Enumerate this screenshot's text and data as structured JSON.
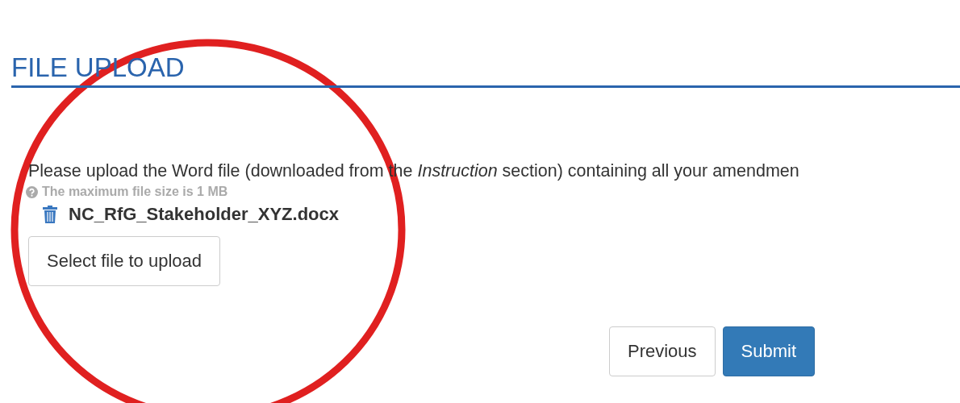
{
  "heading": "FILE UPLOAD",
  "instruction": "Please upload the Word file (downloaded from the *Instruction* section) containing all your amendmen",
  "help_text": "The maximum file size is 1 MB",
  "files": [
    {
      "name": "NC_RfG_Stakeholder_XYZ.docx"
    }
  ],
  "select_button": "Select file to upload",
  "buttons": [
    {
      "label": "Previous",
      "kind": "default"
    },
    {
      "label": "Submit",
      "kind": "primary"
    }
  ]
}
